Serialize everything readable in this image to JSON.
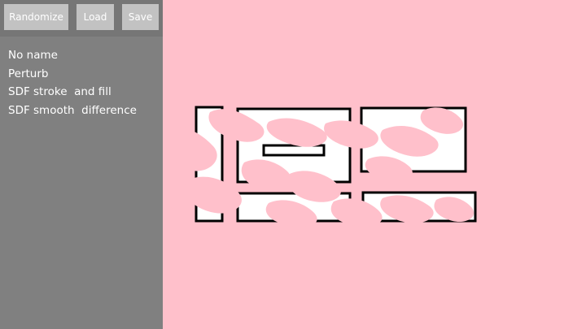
{
  "toolbar": {
    "randomize_label": "Randomize",
    "load_label": "Load",
    "save_label": "Save"
  },
  "menu": {
    "items": [
      "No name",
      "Perturb",
      "SDF stroke  and fill",
      "SDF smooth  difference"
    ]
  },
  "colors": {
    "background": "#ffc0cb",
    "sidebar": "#808080",
    "toolbar": "#767676",
    "button": "#c2c2c2",
    "shape_fill": "#ffffff",
    "shape_stroke": "#000000"
  }
}
